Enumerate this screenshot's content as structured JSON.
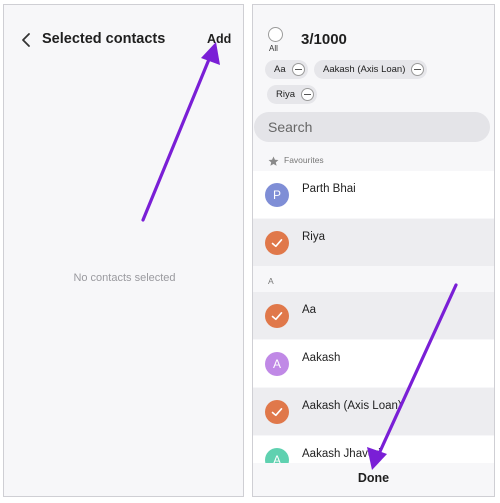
{
  "left": {
    "title": "Selected contacts",
    "add_label": "Add",
    "empty_message": "No contacts selected"
  },
  "right": {
    "all_label": "All",
    "count": "3/1000",
    "chips": [
      {
        "label": "Aa"
      },
      {
        "label": "Aakash (Axis Loan)"
      },
      {
        "label": "Riya"
      }
    ],
    "search_placeholder": "Search",
    "favourites_label": "Favourites",
    "favourites": [
      {
        "name": "Parth Bhai",
        "initial": "P",
        "selected": false,
        "avatar_color": "#7f8ed6"
      },
      {
        "name": "Riya",
        "initial": "",
        "selected": true,
        "avatar_color": "#e0784a"
      }
    ],
    "section_a_label": "A",
    "contacts": [
      {
        "name": "Aa",
        "initial": "",
        "selected": true,
        "avatar_color": "#e0784a"
      },
      {
        "name": "Aakash",
        "initial": "A",
        "selected": false,
        "avatar_color": "#c089e6"
      },
      {
        "name": "Aakash (Axis Loan)",
        "initial": "",
        "selected": true,
        "avatar_color": "#e0784a"
      },
      {
        "name": "Aakash Jhaveri",
        "initial": "A",
        "selected": false,
        "avatar_color": "#5fd1b0"
      }
    ],
    "done_label": "Done"
  },
  "colors": {
    "accent_arrow": "#7a1fd6",
    "selected_avatar": "#e0784a"
  }
}
